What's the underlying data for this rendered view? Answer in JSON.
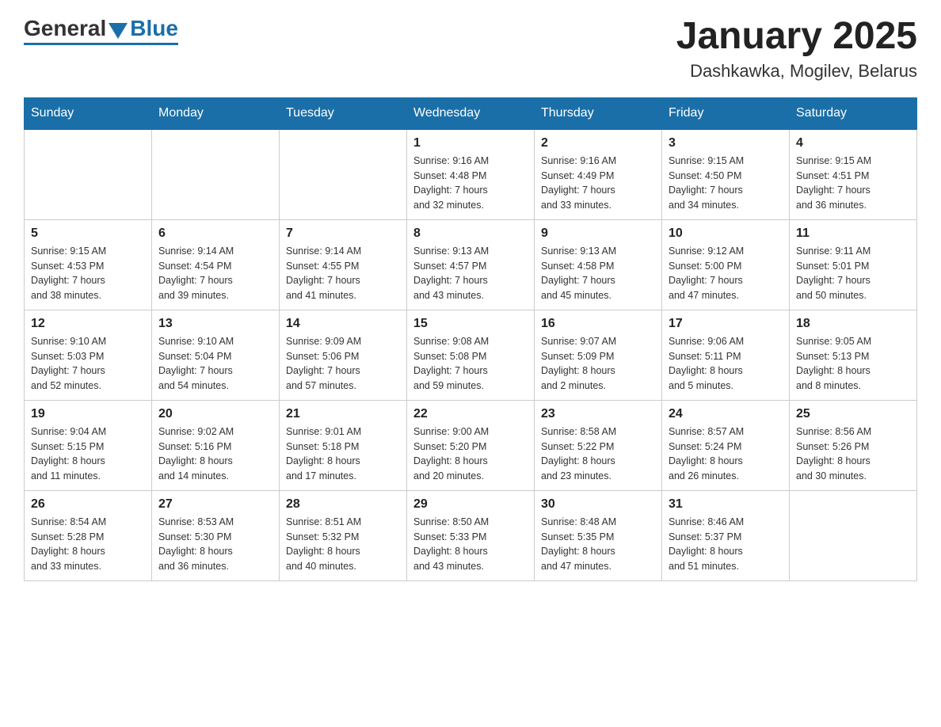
{
  "header": {
    "logo_general": "General",
    "logo_blue": "Blue",
    "month_title": "January 2025",
    "location": "Dashkawka, Mogilev, Belarus"
  },
  "days_of_week": [
    "Sunday",
    "Monday",
    "Tuesday",
    "Wednesday",
    "Thursday",
    "Friday",
    "Saturday"
  ],
  "weeks": [
    [
      {
        "day": "",
        "info": ""
      },
      {
        "day": "",
        "info": ""
      },
      {
        "day": "",
        "info": ""
      },
      {
        "day": "1",
        "info": "Sunrise: 9:16 AM\nSunset: 4:48 PM\nDaylight: 7 hours\nand 32 minutes."
      },
      {
        "day": "2",
        "info": "Sunrise: 9:16 AM\nSunset: 4:49 PM\nDaylight: 7 hours\nand 33 minutes."
      },
      {
        "day": "3",
        "info": "Sunrise: 9:15 AM\nSunset: 4:50 PM\nDaylight: 7 hours\nand 34 minutes."
      },
      {
        "day": "4",
        "info": "Sunrise: 9:15 AM\nSunset: 4:51 PM\nDaylight: 7 hours\nand 36 minutes."
      }
    ],
    [
      {
        "day": "5",
        "info": "Sunrise: 9:15 AM\nSunset: 4:53 PM\nDaylight: 7 hours\nand 38 minutes."
      },
      {
        "day": "6",
        "info": "Sunrise: 9:14 AM\nSunset: 4:54 PM\nDaylight: 7 hours\nand 39 minutes."
      },
      {
        "day": "7",
        "info": "Sunrise: 9:14 AM\nSunset: 4:55 PM\nDaylight: 7 hours\nand 41 minutes."
      },
      {
        "day": "8",
        "info": "Sunrise: 9:13 AM\nSunset: 4:57 PM\nDaylight: 7 hours\nand 43 minutes."
      },
      {
        "day": "9",
        "info": "Sunrise: 9:13 AM\nSunset: 4:58 PM\nDaylight: 7 hours\nand 45 minutes."
      },
      {
        "day": "10",
        "info": "Sunrise: 9:12 AM\nSunset: 5:00 PM\nDaylight: 7 hours\nand 47 minutes."
      },
      {
        "day": "11",
        "info": "Sunrise: 9:11 AM\nSunset: 5:01 PM\nDaylight: 7 hours\nand 50 minutes."
      }
    ],
    [
      {
        "day": "12",
        "info": "Sunrise: 9:10 AM\nSunset: 5:03 PM\nDaylight: 7 hours\nand 52 minutes."
      },
      {
        "day": "13",
        "info": "Sunrise: 9:10 AM\nSunset: 5:04 PM\nDaylight: 7 hours\nand 54 minutes."
      },
      {
        "day": "14",
        "info": "Sunrise: 9:09 AM\nSunset: 5:06 PM\nDaylight: 7 hours\nand 57 minutes."
      },
      {
        "day": "15",
        "info": "Sunrise: 9:08 AM\nSunset: 5:08 PM\nDaylight: 7 hours\nand 59 minutes."
      },
      {
        "day": "16",
        "info": "Sunrise: 9:07 AM\nSunset: 5:09 PM\nDaylight: 8 hours\nand 2 minutes."
      },
      {
        "day": "17",
        "info": "Sunrise: 9:06 AM\nSunset: 5:11 PM\nDaylight: 8 hours\nand 5 minutes."
      },
      {
        "day": "18",
        "info": "Sunrise: 9:05 AM\nSunset: 5:13 PM\nDaylight: 8 hours\nand 8 minutes."
      }
    ],
    [
      {
        "day": "19",
        "info": "Sunrise: 9:04 AM\nSunset: 5:15 PM\nDaylight: 8 hours\nand 11 minutes."
      },
      {
        "day": "20",
        "info": "Sunrise: 9:02 AM\nSunset: 5:16 PM\nDaylight: 8 hours\nand 14 minutes."
      },
      {
        "day": "21",
        "info": "Sunrise: 9:01 AM\nSunset: 5:18 PM\nDaylight: 8 hours\nand 17 minutes."
      },
      {
        "day": "22",
        "info": "Sunrise: 9:00 AM\nSunset: 5:20 PM\nDaylight: 8 hours\nand 20 minutes."
      },
      {
        "day": "23",
        "info": "Sunrise: 8:58 AM\nSunset: 5:22 PM\nDaylight: 8 hours\nand 23 minutes."
      },
      {
        "day": "24",
        "info": "Sunrise: 8:57 AM\nSunset: 5:24 PM\nDaylight: 8 hours\nand 26 minutes."
      },
      {
        "day": "25",
        "info": "Sunrise: 8:56 AM\nSunset: 5:26 PM\nDaylight: 8 hours\nand 30 minutes."
      }
    ],
    [
      {
        "day": "26",
        "info": "Sunrise: 8:54 AM\nSunset: 5:28 PM\nDaylight: 8 hours\nand 33 minutes."
      },
      {
        "day": "27",
        "info": "Sunrise: 8:53 AM\nSunset: 5:30 PM\nDaylight: 8 hours\nand 36 minutes."
      },
      {
        "day": "28",
        "info": "Sunrise: 8:51 AM\nSunset: 5:32 PM\nDaylight: 8 hours\nand 40 minutes."
      },
      {
        "day": "29",
        "info": "Sunrise: 8:50 AM\nSunset: 5:33 PM\nDaylight: 8 hours\nand 43 minutes."
      },
      {
        "day": "30",
        "info": "Sunrise: 8:48 AM\nSunset: 5:35 PM\nDaylight: 8 hours\nand 47 minutes."
      },
      {
        "day": "31",
        "info": "Sunrise: 8:46 AM\nSunset: 5:37 PM\nDaylight: 8 hours\nand 51 minutes."
      },
      {
        "day": "",
        "info": ""
      }
    ]
  ]
}
